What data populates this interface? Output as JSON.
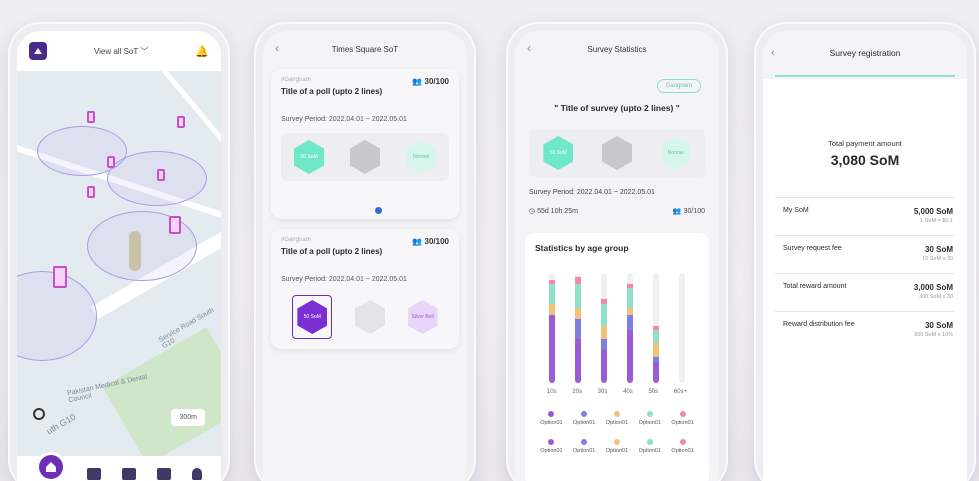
{
  "screen1": {
    "top_bar_title": "View all SoT",
    "scale_label": "300m",
    "map_labels": [
      "Service Road South G10",
      "Pakistan Medical & Dental Council",
      "uth G10"
    ],
    "colors": {
      "accent": "#6c2fb5",
      "pin": "#c94fc9"
    }
  },
  "screen2": {
    "header_title": "Times Square SoT",
    "cards": [
      {
        "tag": "#Gangnam",
        "count": "30/100",
        "title": "Title of a poll (upto 2 lines)",
        "period": "Survey Period: 2022.04.01 ~ 2022.05.01",
        "hex_labels": [
          "50 SoM",
          "",
          "Normal"
        ]
      },
      {
        "tag": "#Gangnam",
        "count": "30/100",
        "title": "Title of a poll (upto 2 lines)",
        "period": "Survey Period: 2022.04.01 ~ 2022.05.01",
        "hex_labels": [
          "50 SoM",
          "",
          "Silver Bell"
        ]
      }
    ]
  },
  "screen3": {
    "header_title": "Survey Statistics",
    "badge": "Gangnam",
    "survey_title": "\" Title of survey (upto 2 lines) \"",
    "hex_labels": [
      "50 SoM",
      "",
      "Normal"
    ],
    "period": "Survey Period: 2022.04.01 ~ 2022.05.01",
    "time_left": "55d 10h 25m",
    "count": "30/100",
    "stats_title": "Statistics by age group",
    "chart_data": {
      "type": "bar",
      "categories": [
        "10s",
        "20s",
        "30s",
        "40s",
        "50s",
        "60s+"
      ],
      "series": [
        {
          "name": "Option01",
          "color": "#9b5bd6",
          "values": [
            0.62,
            0.4,
            0.3,
            0.48,
            0.18,
            0
          ]
        },
        {
          "name": "Option01",
          "color": "#7f7fe0",
          "values": [
            0,
            0.18,
            0.1,
            0.14,
            0.06,
            0
          ]
        },
        {
          "name": "Option01",
          "color": "#f2c27a",
          "values": [
            0.1,
            0.1,
            0.12,
            0.06,
            0.12,
            0
          ]
        },
        {
          "name": "Option01",
          "color": "#8fe0c8",
          "values": [
            0.18,
            0.22,
            0.2,
            0.18,
            0.12,
            0
          ]
        },
        {
          "name": "Option01",
          "color": "#f08aa0",
          "values": [
            0.04,
            0.06,
            0.04,
            0.04,
            0.04,
            0
          ]
        }
      ]
    },
    "legend_rows": [
      [
        {
          "label": "Option01",
          "color": "#9b5bd6"
        },
        {
          "label": "Option01",
          "color": "#7f7fe0"
        },
        {
          "label": "Option01",
          "color": "#f2c27a"
        },
        {
          "label": "Option01",
          "color": "#8fe0c8"
        },
        {
          "label": "Option01",
          "color": "#f08aa0"
        }
      ],
      [
        {
          "label": "Option01",
          "color": "#9b5bd6"
        },
        {
          "label": "Option01",
          "color": "#7f7fe0"
        },
        {
          "label": "Option01",
          "color": "#f2c27a"
        },
        {
          "label": "Option01",
          "color": "#8fe0c8"
        },
        {
          "label": "Option01",
          "color": "#f08aa0"
        }
      ]
    ]
  },
  "screen4": {
    "header_title": "Survey registration",
    "total_label": "Total payment amount",
    "total_value": "3,080 SoM",
    "rows": [
      {
        "label": "My SoM",
        "amount": "5,000 SoM",
        "sub": "1 SoM = $0.1"
      },
      {
        "label": "Survey request fee",
        "amount": "30 SoM",
        "sub": "10 SoM x 30"
      },
      {
        "label": "Total reward amount",
        "amount": "3,000 SoM",
        "sub": "300 SoM x 30"
      },
      {
        "label": "Reward distribution fee",
        "amount": "30 SoM",
        "sub": "300 SoM x 10%"
      }
    ]
  }
}
